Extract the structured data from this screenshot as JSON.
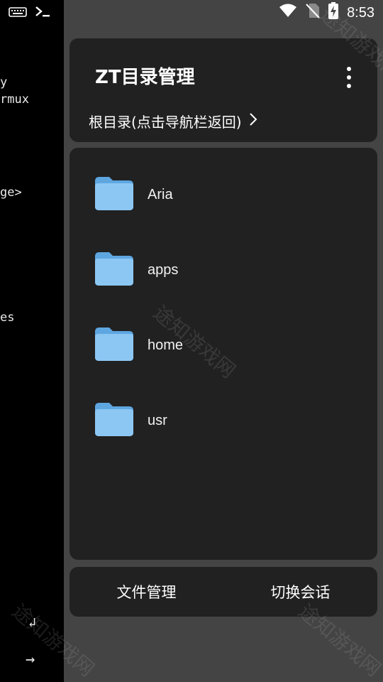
{
  "status": {
    "time": "8:53",
    "icons": [
      "keyboard-icon",
      "terminal-prompt-icon",
      "wifi-icon",
      "no-sim-icon",
      "battery-charging-icon"
    ]
  },
  "terminal": {
    "lines": [
      "y",
      "rmux",
      "ge>",
      "es"
    ],
    "enter_key": "↲",
    "arrow_key": "→"
  },
  "header": {
    "title": "ZT目录管理",
    "breadcrumb": "根目录(点击导航栏返回)"
  },
  "folders": [
    {
      "name": "Aria"
    },
    {
      "name": "apps"
    },
    {
      "name": "home"
    },
    {
      "name": "usr"
    }
  ],
  "bottom": {
    "file_manager": "文件管理",
    "switch_session": "切换会话"
  },
  "watermark": "途知游戏网",
  "colors": {
    "drawer_bg": "#444444",
    "card_bg": "#212121",
    "folder": "#8cc7f4"
  }
}
